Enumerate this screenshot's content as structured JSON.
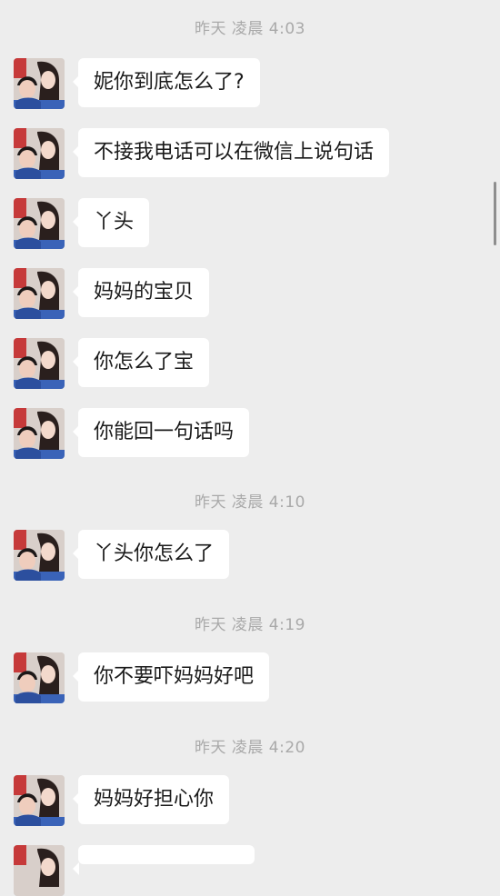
{
  "timestamps": [
    "昨天 凌晨 4:03",
    "昨天 凌晨 4:10",
    "昨天 凌晨 4:19",
    "昨天 凌晨 4:20"
  ],
  "messages": [
    "妮你到底怎么了?",
    "不接我电话可以在微信上说句话",
    "丫头",
    "妈妈的宝贝",
    "你怎么了宝",
    "你能回一句话吗",
    "丫头你怎么了",
    "你不要吓妈妈好吧",
    "妈妈好担心你",
    ""
  ],
  "colors": {
    "background": "#ededed",
    "bubble": "#ffffff",
    "timestamp_text": "#a9a9a9",
    "message_text": "#1a1a1a"
  },
  "icons": {
    "avatar": "photo-avatar"
  }
}
